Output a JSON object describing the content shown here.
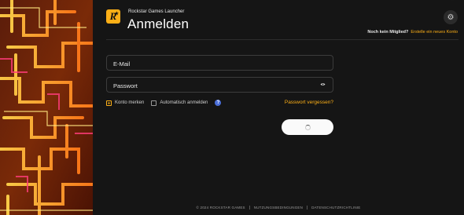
{
  "app": {
    "title": "Rockstar Games Launcher",
    "logo_letter": "R"
  },
  "page": {
    "title": "Anmelden"
  },
  "signup": {
    "question": "Noch kein Mitglied?",
    "link": "Erstelle ein neues Konto"
  },
  "form": {
    "email_placeholder": "E-Mail",
    "password_placeholder": "Passwort",
    "remember_label": "Konto merken",
    "remember_checked": true,
    "auto_login_label": "Automatisch anmelden",
    "auto_login_checked": false,
    "help_icon": "?",
    "forgot_link": "Passwort vergessen?"
  },
  "footer": {
    "copyright": "© 2024 ROCKSTAR GAMES",
    "terms": "NUTZUNGSBEDINGUNGEN",
    "privacy": "DATENSCHUTZRICHTLINIE"
  },
  "colors": {
    "accent": "#fcaf17",
    "background": "#151515",
    "help": "#4a6ed8"
  },
  "icons": {
    "settings": "gear-icon",
    "password_toggle": "eye-icon",
    "loading": "spinner-icon"
  }
}
